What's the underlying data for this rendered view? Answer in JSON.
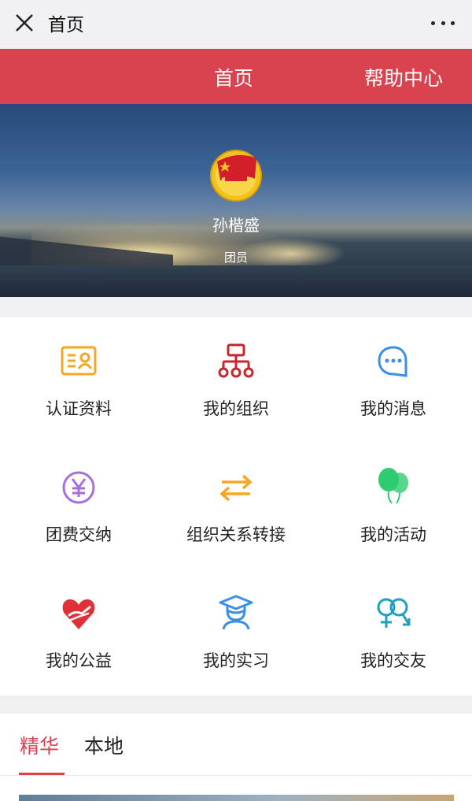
{
  "titlebar": {
    "title": "首页"
  },
  "nav": {
    "home": "首页",
    "help": "帮助中心"
  },
  "profile": {
    "name": "孙楷盛",
    "role": "团员"
  },
  "menu": [
    {
      "label": "认证资料",
      "icon": "id-card-icon",
      "color": "#f5a623"
    },
    {
      "label": "我的组织",
      "icon": "org-chart-icon",
      "color": "#c8252e"
    },
    {
      "label": "我的消息",
      "icon": "chat-bubble-icon",
      "color": "#3c8fe6"
    },
    {
      "label": "团费交纳",
      "icon": "yuan-coin-icon",
      "color": "#a86ee0"
    },
    {
      "label": "组织关系转接",
      "icon": "transfer-arrows-icon",
      "color": "#f5a623"
    },
    {
      "label": "我的活动",
      "icon": "balloons-icon",
      "color": "#2ecc71"
    },
    {
      "label": "我的公益",
      "icon": "heart-hand-icon",
      "color": "#e0303a"
    },
    {
      "label": "我的实习",
      "icon": "graduate-icon",
      "color": "#3c8fe6"
    },
    {
      "label": "我的交友",
      "icon": "gender-icon",
      "color": "#20a0c0"
    }
  ],
  "tabs": {
    "featured": "精华",
    "local": "本地"
  },
  "colors": {
    "brand_red": "#d9434f",
    "titlebar_bg": "#f1f1f3",
    "page_bg": "#f0f0f2"
  }
}
